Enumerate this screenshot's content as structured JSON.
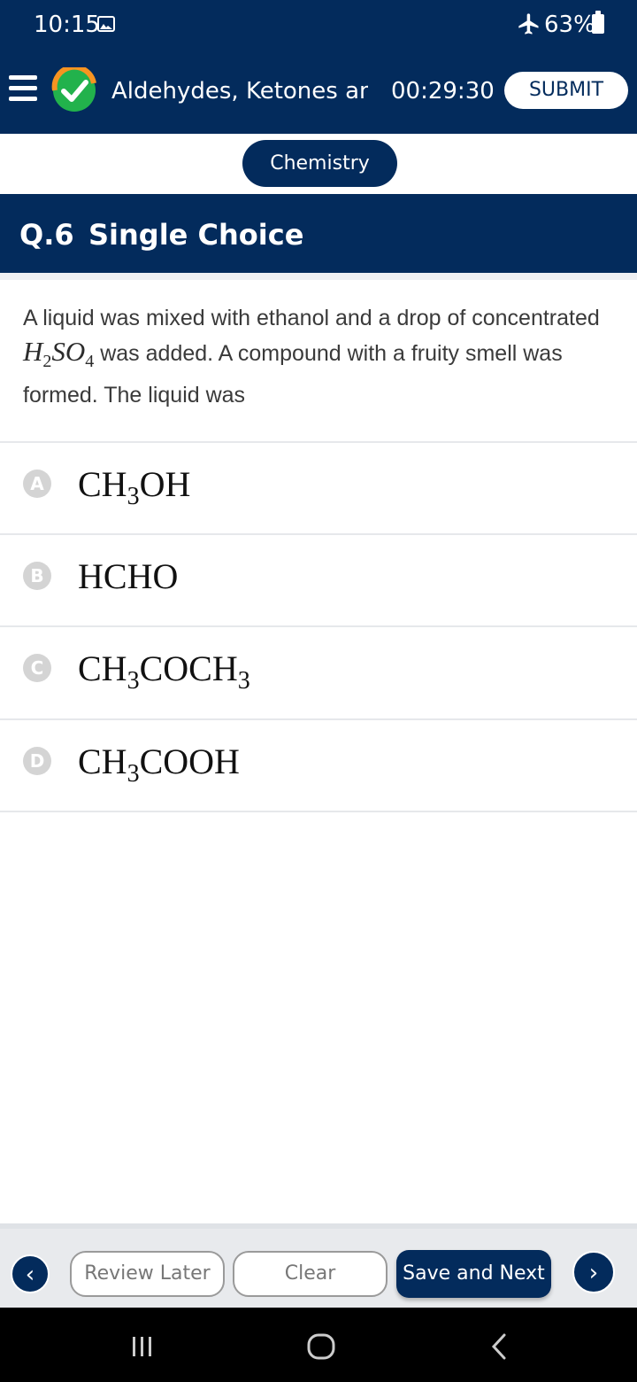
{
  "status_bar": {
    "time": "10:15",
    "battery": "63%",
    "icons": [
      "gallery-icon",
      "airplane-icon",
      "battery-icon"
    ]
  },
  "header": {
    "title": "Aldehydes, Ketones and",
    "timer": "00:29:30",
    "submit_label": "SUBMIT",
    "colors": {
      "primary": "#032b5c",
      "logo_green": "#22b24c",
      "logo_orange": "#f79421"
    }
  },
  "subject": "Chemistry",
  "question": {
    "number": "Q.6",
    "type": "Single Choice",
    "text_before": "A liquid was mixed with ethanol and a drop of concentrated ",
    "formula": {
      "h": "H",
      "h_sub": "2",
      "so": "SO",
      "so_sub": "4"
    },
    "text_after": " was added. A compound with a fruity smell was formed. The liquid was"
  },
  "options": [
    {
      "letter": "A",
      "parts": [
        "CH",
        "3",
        "OH"
      ]
    },
    {
      "letter": "B",
      "parts": [
        "HCHO"
      ]
    },
    {
      "letter": "C",
      "parts": [
        "CH",
        "3",
        "COCH",
        "3"
      ]
    },
    {
      "letter": "D",
      "parts": [
        "CH",
        "3",
        "COOH"
      ]
    }
  ],
  "footer": {
    "prev_label": "‹",
    "review_later": "Review Later",
    "clear": "Clear",
    "save_next": "Save and Next",
    "next_label": "›"
  }
}
